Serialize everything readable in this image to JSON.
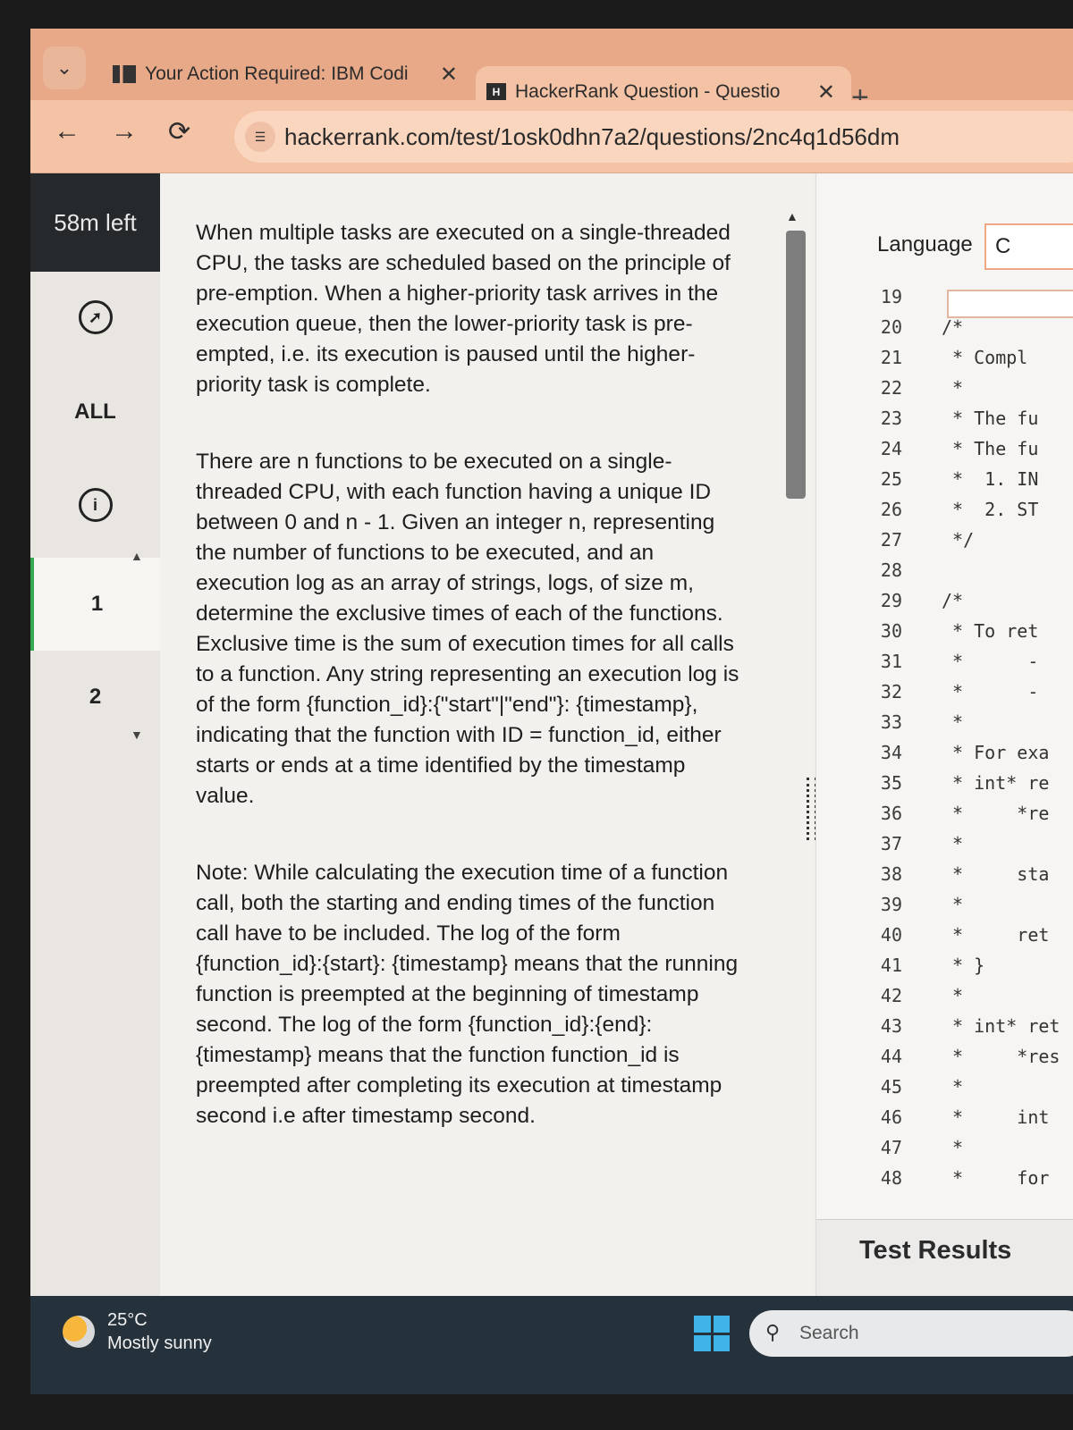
{
  "browser": {
    "tabs": [
      {
        "title": "Your Action Required: IBM Codi",
        "favicon": "ibm-icon",
        "close": "✕"
      },
      {
        "title": "HackerRank Question - Questio",
        "favicon": "hackerrank-icon",
        "favicon_text": "H",
        "close": "✕",
        "active": true
      }
    ],
    "new_tab": "+",
    "url": "hackerrank.com/test/1osk0dhn7a2/questions/2nc4q1d56dm"
  },
  "sidebar": {
    "timer": "58m left",
    "all_label": "ALL",
    "questions": [
      "1",
      "2"
    ]
  },
  "question": {
    "paragraphs": [
      "When multiple tasks are executed on a single-threaded CPU, the tasks are scheduled based on the principle of pre-emption. When a higher-priority task arrives in the execution queue, then the lower-priority task is pre-empted, i.e. its execution is paused until the higher-priority task is complete.",
      "There are n functions to be executed on a single-threaded CPU, with each function having a unique ID between 0 and n - 1. Given an integer n, representing the number of functions to be executed, and an execution log as an array of strings, logs, of size m, determine the exclusive times of each of the functions. Exclusive time is the sum of execution times for all calls to a function. Any string representing an execution log is of the form {function_id}:{\"start\"|\"end\"}: {timestamp}, indicating that the function with ID = function_id, either starts or ends at a time identified by the timestamp value.",
      "Note: While calculating the execution time of a function call, both the starting and ending times of the function call have to be included. The log of the form {function_id}:{start}: {timestamp} means that the running function is preempted at the beginning of timestamp second. The log of the form {function_id}:{end}: {timestamp} means that the function function_id is preempted after completing its execution at timestamp second i.e after timestamp second."
    ]
  },
  "editor": {
    "language_label": "Language",
    "language_value": "C",
    "lines": [
      {
        "n": "19",
        "code": ""
      },
      {
        "n": "20",
        "code": "/*"
      },
      {
        "n": "21",
        "code": " * Compl"
      },
      {
        "n": "22",
        "code": " *"
      },
      {
        "n": "23",
        "code": " * The fu"
      },
      {
        "n": "24",
        "code": " * The fu"
      },
      {
        "n": "25",
        "code": " *  1. IN"
      },
      {
        "n": "26",
        "code": " *  2. ST"
      },
      {
        "n": "27",
        "code": " */"
      },
      {
        "n": "28",
        "code": ""
      },
      {
        "n": "29",
        "code": "/*"
      },
      {
        "n": "30",
        "code": " * To ret"
      },
      {
        "n": "31",
        "code": " *      -"
      },
      {
        "n": "32",
        "code": " *      -"
      },
      {
        "n": "33",
        "code": " *"
      },
      {
        "n": "34",
        "code": " * For exa"
      },
      {
        "n": "35",
        "code": " * int* re"
      },
      {
        "n": "36",
        "code": " *     *re"
      },
      {
        "n": "37",
        "code": " *"
      },
      {
        "n": "38",
        "code": " *     sta"
      },
      {
        "n": "39",
        "code": " *"
      },
      {
        "n": "40",
        "code": " *     ret"
      },
      {
        "n": "41",
        "code": " * }"
      },
      {
        "n": "42",
        "code": " *"
      },
      {
        "n": "43",
        "code": " * int* ret"
      },
      {
        "n": "44",
        "code": " *     *res"
      },
      {
        "n": "45",
        "code": " *"
      },
      {
        "n": "46",
        "code": " *     int"
      },
      {
        "n": "47",
        "code": " *"
      },
      {
        "n": "48",
        "code": " *     for"
      }
    ],
    "test_results_label": "Test Results"
  },
  "taskbar": {
    "temperature": "25°C",
    "weather": "Mostly sunny",
    "search_label": "Search"
  }
}
